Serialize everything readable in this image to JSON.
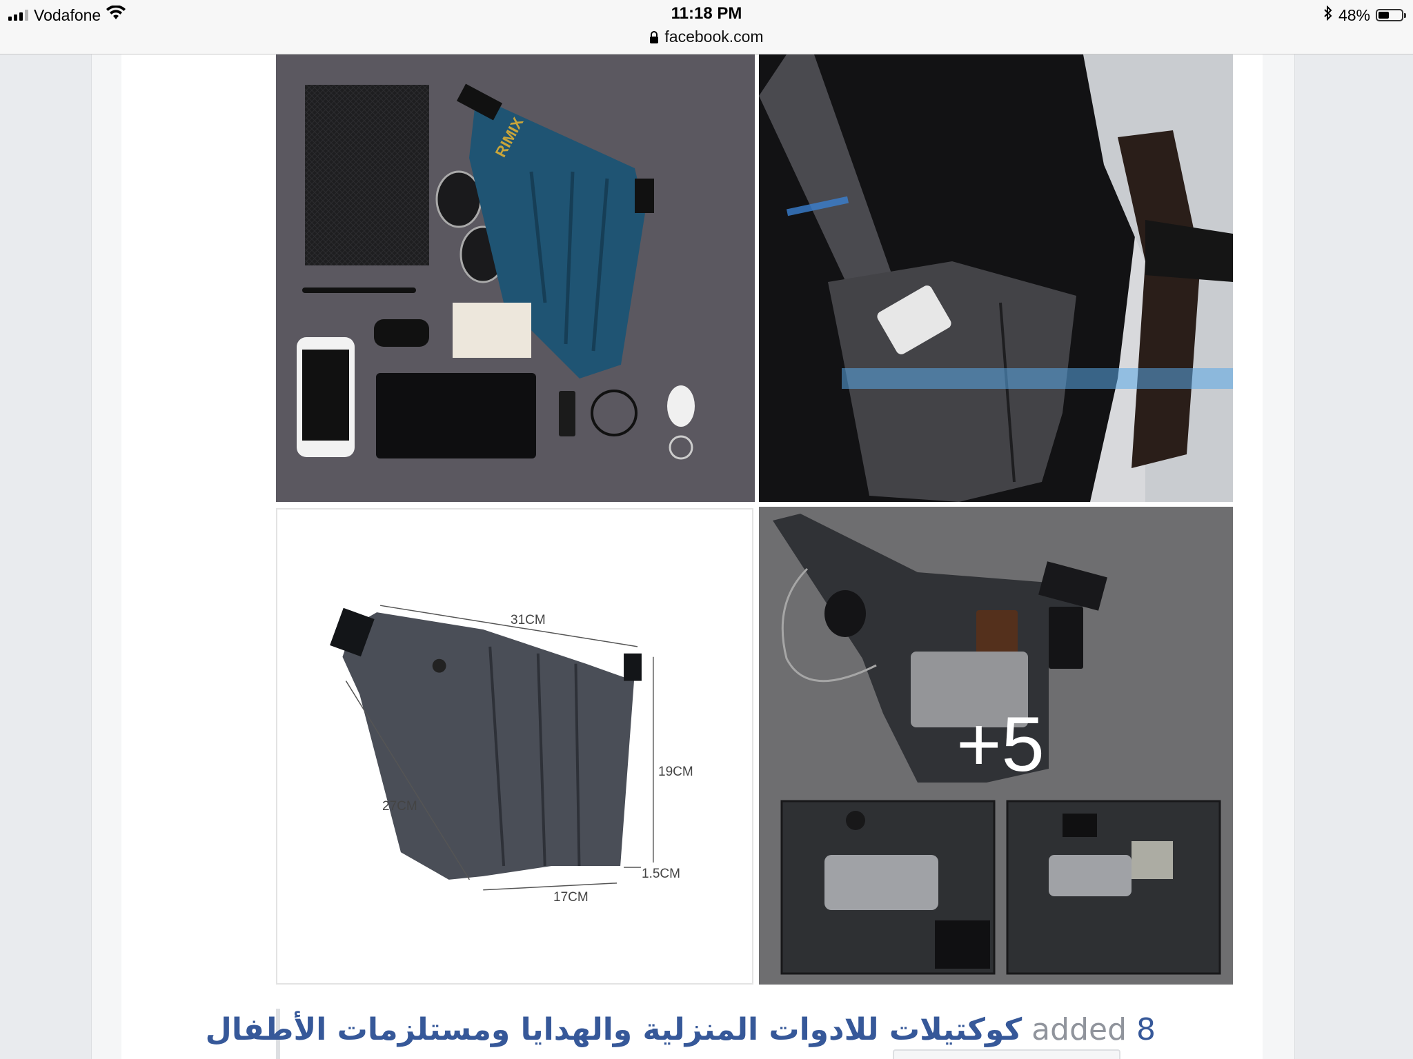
{
  "status_bar": {
    "carrier": "Vodafone",
    "time": "11:18 PM",
    "url": "facebook.com",
    "battery": "48%",
    "battery_level": 0.48
  },
  "post": {
    "photos": [
      {
        "name": "product-flatlay",
        "brand_text": "RIMIX"
      },
      {
        "name": "worn-by-model"
      },
      {
        "name": "dimensions-diagram",
        "dimensions": [
          "31CM",
          "19CM",
          "27CM",
          "1.5CM",
          "17CM"
        ]
      },
      {
        "name": "detail-views",
        "more_count": "+5"
      }
    ],
    "caption": {
      "count": "8",
      "added_word": "added",
      "group_name": "كوكتيلات للادوات المنزلية والهدايا ومستلزمات الأطفال"
    }
  }
}
